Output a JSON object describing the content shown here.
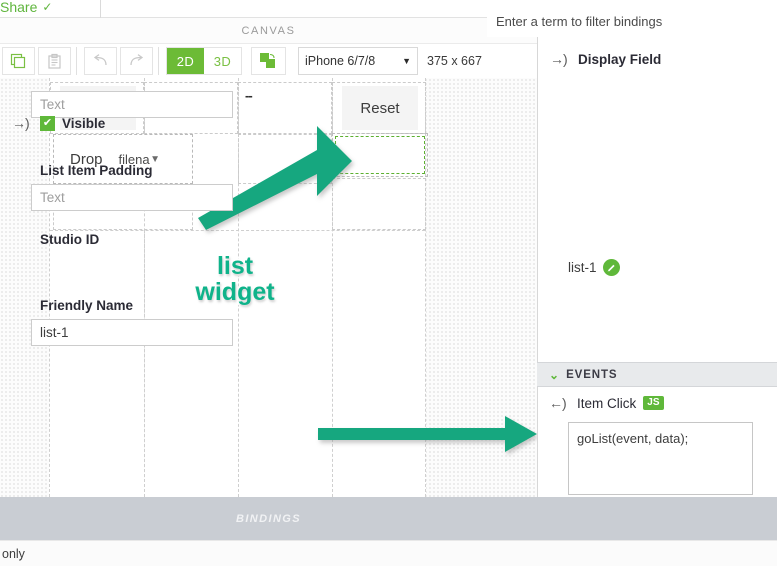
{
  "topbar": {
    "share_label": "Share",
    "share_caret": "chevron-down-icon"
  },
  "canvas_panel": {
    "header_label": "CANVAS",
    "toolbar": {
      "copy_label": "copy-icon",
      "paste_label": "paste-icon",
      "undo_label": "undo-icon",
      "redo_label": "redo-icon",
      "view_2d": "2D",
      "view_3d": "3D",
      "image_tool": "image-tool-icon",
      "device": "iPhone 6/7/8",
      "device_caret": "▼",
      "dimensions": "375 x 667"
    },
    "widgets": {
      "play_button": "play",
      "dashes_label": "--",
      "reset_button": "Reset",
      "dropdown_label": "Drop",
      "dropdown_value": "filena",
      "dropdown_caret": "▼"
    },
    "annotation": {
      "line1": "list",
      "line2": "widget"
    }
  },
  "properties": {
    "display_field": {
      "label": "Display Field",
      "value": "",
      "placeholder": "Text",
      "binding_icon": "→)"
    },
    "visible": {
      "label": "Visible",
      "checked": true,
      "check_glyph": "✔",
      "binding_icon": "→)"
    },
    "list_item_padding": {
      "label": "List Item Padding",
      "value": "",
      "placeholder": "Text"
    },
    "studio_id": {
      "label": "Studio ID",
      "value": "list-1",
      "edit_icon": "✎"
    },
    "friendly_name": {
      "label": "Friendly Name",
      "value": "list-1",
      "placeholder": ""
    }
  },
  "events": {
    "section_title": "EVENTS",
    "chevron": "⌄",
    "item_click": {
      "label": "Item Click",
      "binding_icon": "←)",
      "badge": "JS",
      "code": "goList(event, data);"
    }
  },
  "bindings_bar": {
    "title": "BINDINGS",
    "filter_placeholder": "Enter a term to filter bindings",
    "filter_value": ""
  },
  "bottom_strip": {
    "text": "only"
  },
  "colors": {
    "accent_green": "#5fb83a",
    "annotation_teal": "#0fb38a",
    "bindings_bar": "#c9cdd3",
    "select_border": "#5cb030"
  }
}
